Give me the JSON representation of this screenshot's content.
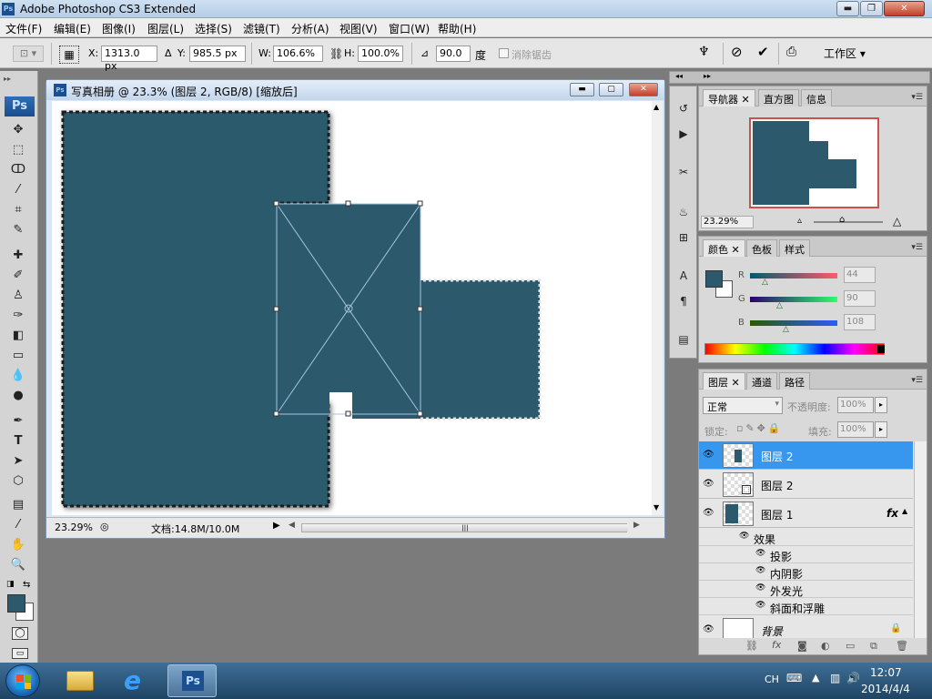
{
  "window": {
    "app_icon": "Ps",
    "title": "Adobe Photoshop CS3 Extended"
  },
  "menu": [
    "文件(F)",
    "编辑(E)",
    "图像(I)",
    "图层(L)",
    "选择(S)",
    "滤镜(T)",
    "分析(A)",
    "视图(V)",
    "窗口(W)",
    "帮助(H)"
  ],
  "options": {
    "x_label": "X:",
    "x_value": "1313.0 px",
    "y_label": "Y:",
    "y_value": "985.5 px",
    "w_label": "W:",
    "w_value": "106.6%",
    "h_label": "H:",
    "h_value": "100.0%",
    "angle_value": "90.0",
    "angle_unit": "度",
    "antialias_label": "消除锯齿",
    "workspace_label": "工作区 ▾"
  },
  "toolbox": {
    "badge": "Ps"
  },
  "document": {
    "title": "写真相册 @ 23.3% (图层 2, RGB/8) [缩放后]",
    "zoom": "23.29%",
    "doc_info": "文档:14.8M/10.0M",
    "shape_color": "#2c5a6c"
  },
  "navigator": {
    "tabs": [
      "导航器",
      "直方图",
      "信息"
    ],
    "zoom": "23.29%"
  },
  "color_panel": {
    "tabs": [
      "颜色",
      "色板",
      "样式"
    ],
    "r_label": "R",
    "r_value": "44",
    "g_label": "G",
    "g_value": "90",
    "b_label": "B",
    "b_value": "108",
    "fg_color": "#2c5a6c"
  },
  "layers_panel": {
    "tabs": [
      "图层",
      "通道",
      "路径"
    ],
    "blend_mode": "正常",
    "opacity_label": "不透明度:",
    "opacity_value": "100%",
    "lock_label": "锁定:",
    "fill_label": "填充:",
    "fill_value": "100%",
    "layers": [
      {
        "name": "图层 2",
        "selected": true
      },
      {
        "name": "图层 2",
        "selected": false
      },
      {
        "name": "图层 1",
        "selected": false,
        "fx": "fx"
      }
    ],
    "effects_label": "效果",
    "effects": [
      "投影",
      "内阴影",
      "外发光",
      "斜面和浮雕"
    ],
    "background": "背景"
  },
  "taskbar": {
    "lang": "CH",
    "time": "12:07",
    "date": "2014/4/4",
    "active_app": "Ps"
  }
}
